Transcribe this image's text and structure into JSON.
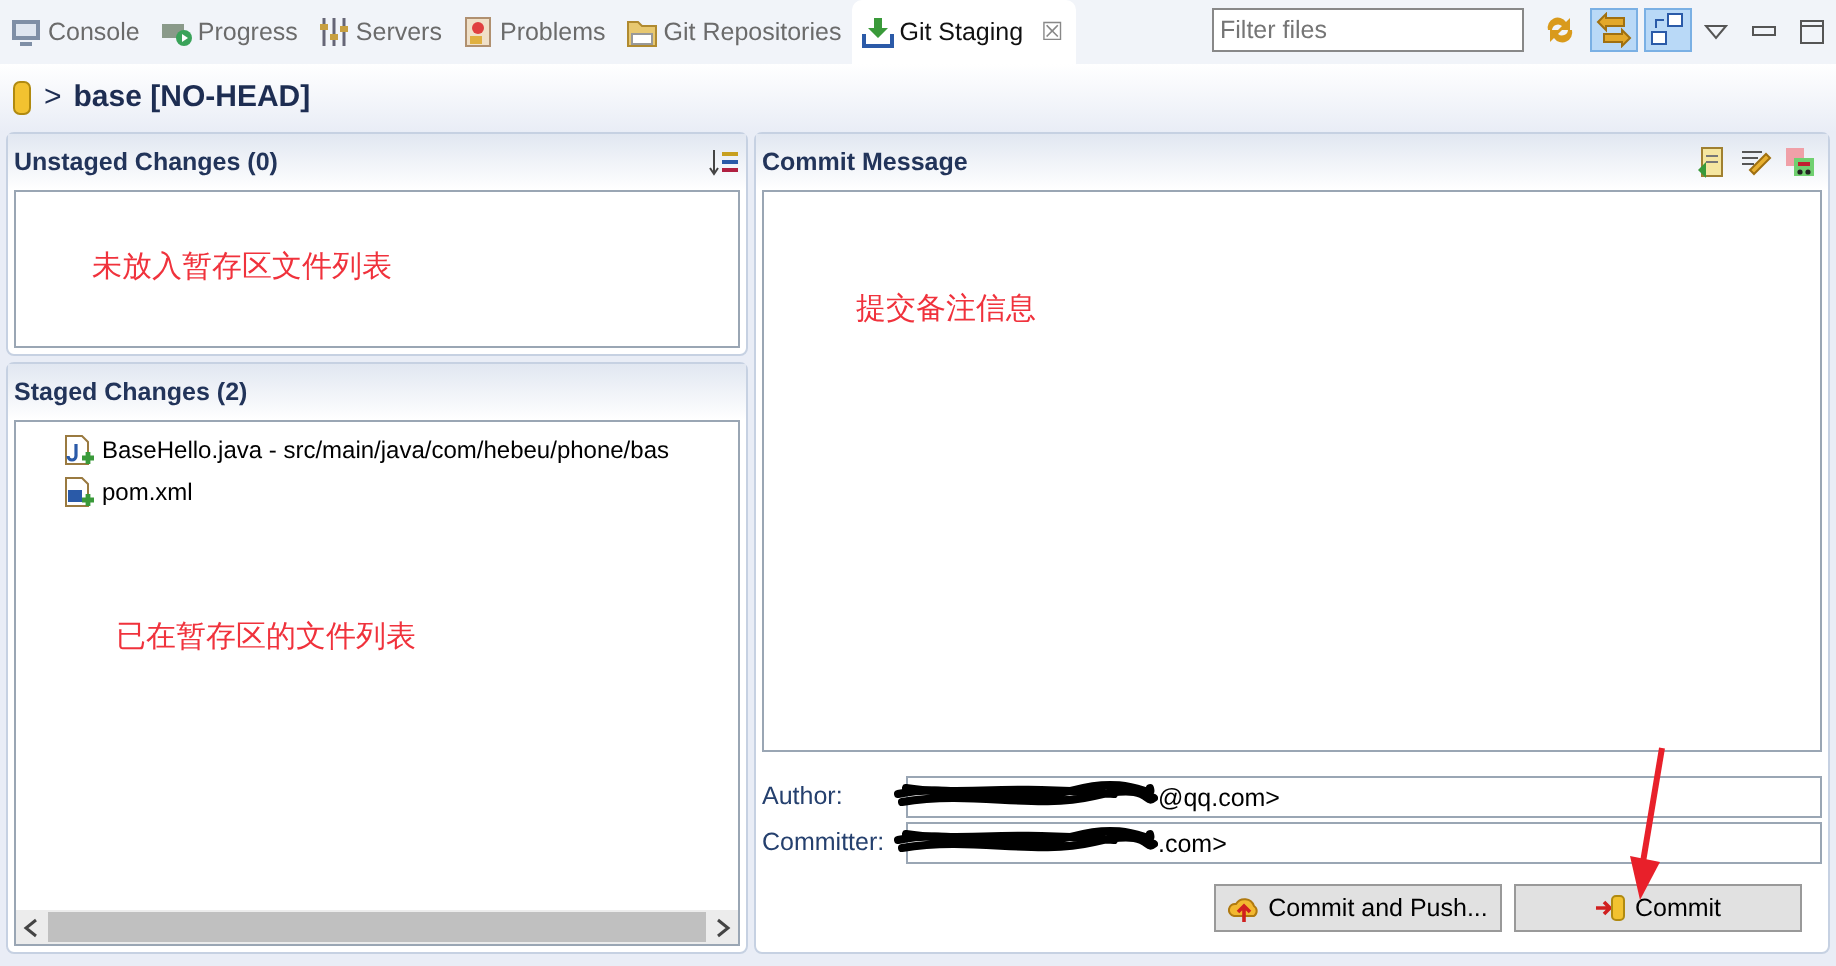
{
  "tabs": [
    {
      "kind": "console",
      "label": "Console",
      "selected": false
    },
    {
      "kind": "progress",
      "label": "Progress",
      "selected": false
    },
    {
      "kind": "servers",
      "label": "Servers",
      "selected": false
    },
    {
      "kind": "problems",
      "label": "Problems",
      "selected": false
    },
    {
      "kind": "git",
      "label": "Git Repositories",
      "selected": false
    },
    {
      "kind": "staging",
      "label": "Git Staging",
      "selected": true,
      "close": "☒"
    }
  ],
  "filter": {
    "placeholder": "Filter files"
  },
  "toolbar": [
    {
      "kind": "sync",
      "pressed": false
    },
    {
      "kind": "compare",
      "pressed": true
    },
    {
      "kind": "layout",
      "pressed": true
    }
  ],
  "repo": {
    "separator": ">",
    "title": "base [NO-HEAD]"
  },
  "unstaged": {
    "title": "Unstaged Changes (0)",
    "annotation": "未放入暂存区文件列表"
  },
  "staged": {
    "title": "Staged Changes (2)",
    "annotation": "已在暂存区的文件列表",
    "files": [
      {
        "kind": "java",
        "label": "BaseHello.java - src/main/java/com/hebeu/phone/bas"
      },
      {
        "kind": "xml",
        "label": "pom.xml"
      }
    ]
  },
  "commit": {
    "title": "Commit Message",
    "annotation": "提交备注信息",
    "author_label": "Author:",
    "author": "@qq.com>",
    "committer_label": "Committer:",
    "committer": ".com>",
    "buttons": [
      {
        "kind": "push",
        "label": "Commit and Push..."
      },
      {
        "kind": "commit",
        "label": "Commit"
      }
    ]
  }
}
